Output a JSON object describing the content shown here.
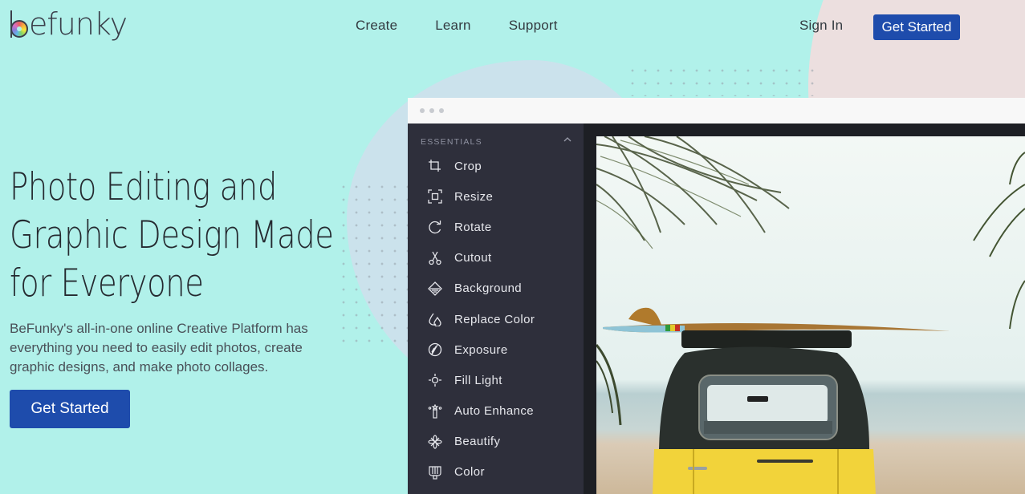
{
  "brand": {
    "name": "befunky",
    "accent": "#1e4cac",
    "background": "#b1f1ea"
  },
  "header": {
    "nav": [
      "Create",
      "Learn",
      "Support"
    ],
    "sign_in": "Sign In",
    "cta": "Get Started"
  },
  "hero": {
    "title_lines": [
      "Photo Editing and",
      "Graphic Design Made",
      "for Everyone"
    ],
    "description": "BeFunky's all-in-one online Creative Platform has everything you need to easily edit photos, create graphic designs, and make photo collages.",
    "cta": "Get Started"
  },
  "app_mockup": {
    "section": "ESSENTIALS",
    "tools": [
      {
        "label": "Crop",
        "icon": "crop-icon"
      },
      {
        "label": "Resize",
        "icon": "resize-icon"
      },
      {
        "label": "Rotate",
        "icon": "rotate-icon"
      },
      {
        "label": "Cutout",
        "icon": "scissors-icon"
      },
      {
        "label": "Background",
        "icon": "background-icon"
      },
      {
        "label": "Replace Color",
        "icon": "droplets-icon"
      },
      {
        "label": "Exposure",
        "icon": "exposure-icon"
      },
      {
        "label": "Fill Light",
        "icon": "fill-light-icon"
      },
      {
        "label": "Auto Enhance",
        "icon": "magic-wand-icon"
      },
      {
        "label": "Beautify",
        "icon": "flower-icon"
      },
      {
        "label": "Color",
        "icon": "color-palette-icon"
      }
    ],
    "photo_description": "Yellow vintage van with a surfboard on the roof under palm trees at the beach"
  }
}
